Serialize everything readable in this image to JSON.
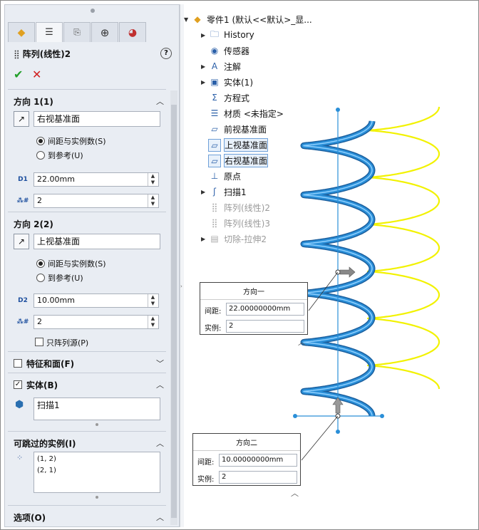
{
  "panel": {
    "title": "阵列(线性)2",
    "help": "?",
    "ok": "✔",
    "cancel": "✕",
    "tabs": [
      "feature-manager",
      "property-manager",
      "configuration-manager",
      "dimxpert",
      "display-manager"
    ]
  },
  "dir1": {
    "heading": "方向 1(1)",
    "reference": "右视基准面",
    "opt_spacing": "间距与实例数(S)",
    "opt_ref": "到参考(U)",
    "spacing": "22.00mm",
    "count": "2"
  },
  "dir2": {
    "heading": "方向 2(2)",
    "reference": "上视基准面",
    "opt_spacing": "间距与实例数(S)",
    "opt_ref": "到参考(U)",
    "spacing": "10.00mm",
    "count": "2",
    "seed_only": "只阵列源(P)"
  },
  "features": {
    "heading": "特征和面(F)"
  },
  "bodies": {
    "heading": "实体(B)",
    "item": "扫描1"
  },
  "skip": {
    "heading": "可跳过的实例(I)",
    "items": [
      "(1, 2)",
      "(2, 1)"
    ]
  },
  "options": {
    "heading": "选项(O)"
  },
  "tree": {
    "root": "零件1 (默认<<默认>_显...",
    "items": [
      {
        "label": "History",
        "arrow": "▶",
        "icon": "history-icon"
      },
      {
        "label": "传感器",
        "arrow": "",
        "icon": "sensor-icon"
      },
      {
        "label": "注解",
        "arrow": "▶",
        "icon": "annotation-icon"
      },
      {
        "label": "实体(1)",
        "arrow": "▶",
        "icon": "solid-body-icon"
      },
      {
        "label": "方程式",
        "arrow": "",
        "icon": "equation-icon"
      },
      {
        "label": "材质 <未指定>",
        "arrow": "",
        "icon": "material-icon"
      },
      {
        "label": "前视基准面",
        "arrow": "",
        "icon": "plane-icon"
      },
      {
        "label": "上视基准面",
        "arrow": "",
        "icon": "plane-icon"
      },
      {
        "label": "右视基准面",
        "arrow": "",
        "icon": "plane-icon"
      },
      {
        "label": "原点",
        "arrow": "",
        "icon": "origin-icon"
      },
      {
        "label": "扫描1",
        "arrow": "▶",
        "icon": "sweep-icon"
      },
      {
        "label": "阵列(线性)2",
        "arrow": "",
        "icon": "linear-pattern-icon"
      },
      {
        "label": "阵列(线性)3",
        "arrow": "",
        "icon": "linear-pattern-icon"
      },
      {
        "label": "切除-拉伸2",
        "arrow": "▶",
        "icon": "cut-extrude-icon"
      }
    ]
  },
  "callout1": {
    "title": "方向一",
    "spacing_label": "间距:",
    "spacing": "22.00000000mm",
    "count_label": "实例:",
    "count": "2"
  },
  "callout2": {
    "title": "方向二",
    "spacing_label": "间距:",
    "spacing": "10.00000000mm",
    "count_label": "实例:",
    "count": "2"
  },
  "colors": {
    "blue_helix": "#2a8fd8",
    "yellow_helix": "#f2f200",
    "panel_bg": "#e9edf3"
  }
}
